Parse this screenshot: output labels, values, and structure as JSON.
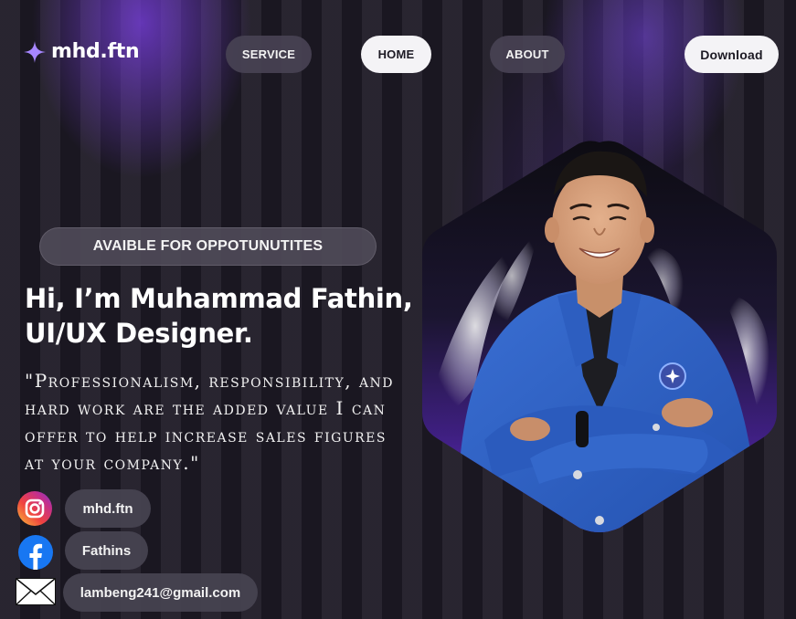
{
  "brand": {
    "name": "mhd.ftn",
    "icon": "sparkle-icon",
    "accent": "#a686ff"
  },
  "nav": {
    "items": [
      {
        "label": "SERVICE",
        "active": false
      },
      {
        "label": "HOME",
        "active": true
      },
      {
        "label": "ABOUT",
        "active": false
      }
    ],
    "download_label": "Download"
  },
  "hero": {
    "badge": "AVAIBLE FOR OPPOTUNUTITES",
    "title_line1": "Hi, I’m Muhammad Fathin,",
    "title_line2": "UI/UX Designer.",
    "quote": "\"Professionalism, responsibility, and hard work are the added value I can offer to help increase sales figures at your company.\""
  },
  "contacts": [
    {
      "icon": "instagram-icon",
      "label": "mhd.ftn"
    },
    {
      "icon": "facebook-icon",
      "label": "Fathins"
    },
    {
      "icon": "mail-icon",
      "label": "lambeng241@gmail.com"
    }
  ],
  "colors": {
    "background": "#1f1b27",
    "purple_glow": "#7c40e6",
    "pill_dark": "#484254",
    "pill_light": "#f4f3f6",
    "jacket_blue": "#2f5fc0"
  }
}
